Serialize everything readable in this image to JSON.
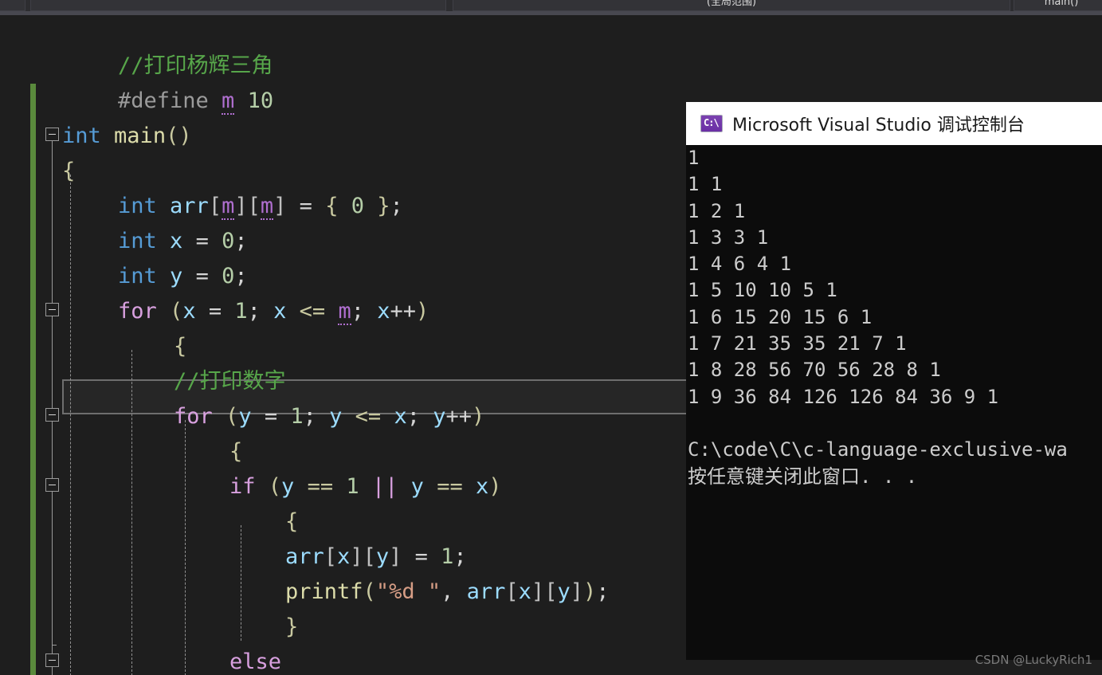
{
  "navbar": {
    "left_label": "",
    "scope_label": "",
    "middle_label": "(全局范围)",
    "member_label": "main()"
  },
  "editor": {
    "language": "C",
    "colors": {
      "background": "#1e1e1e",
      "comment": "#57a64a",
      "keyword": "#569cd6",
      "control_keyword": "#d8a0df",
      "function": "#dcdcaa",
      "variable": "#9cdcfe",
      "number": "#b5cea8",
      "string": "#d69d85",
      "macro": "#b06fd0",
      "change_bar_saved": "#5a8a3c",
      "current_line_border": "#6e6e6e"
    },
    "current_line_index": 8,
    "lines": [
      {
        "indent": 1,
        "tokens": [
          {
            "t": "//打印杨辉三角",
            "c": "c-comment"
          }
        ]
      },
      {
        "indent": 1,
        "tokens": [
          {
            "t": "#define ",
            "c": "c-pp"
          },
          {
            "t": "m",
            "c": "c-macro"
          },
          {
            "t": " ",
            "c": "c-punct"
          },
          {
            "t": "10",
            "c": "c-num"
          }
        ]
      },
      {
        "indent": 0,
        "tokens": [
          {
            "t": "int",
            "c": "c-key"
          },
          {
            "t": " ",
            "c": "c-punct"
          },
          {
            "t": "main",
            "c": "c-fn"
          },
          {
            "t": "()",
            "c": "c-brace"
          }
        ]
      },
      {
        "indent": 0,
        "tokens": [
          {
            "t": "{",
            "c": "c-brace"
          }
        ]
      },
      {
        "indent": 1,
        "tokens": [
          {
            "t": "int",
            "c": "c-key"
          },
          {
            "t": " ",
            "c": "c-punct"
          },
          {
            "t": "arr",
            "c": "c-var"
          },
          {
            "t": "[",
            "c": "c-brk"
          },
          {
            "t": "m",
            "c": "c-macro"
          },
          {
            "t": "]",
            "c": "c-brk"
          },
          {
            "t": "[",
            "c": "c-brk"
          },
          {
            "t": "m",
            "c": "c-macro"
          },
          {
            "t": "]",
            "c": "c-brk"
          },
          {
            "t": " = ",
            "c": "c-punct"
          },
          {
            "t": "{ ",
            "c": "c-brace"
          },
          {
            "t": "0",
            "c": "c-num"
          },
          {
            "t": " }",
            "c": "c-brace"
          },
          {
            "t": ";",
            "c": "c-punct"
          }
        ]
      },
      {
        "indent": 1,
        "tokens": [
          {
            "t": "int",
            "c": "c-key"
          },
          {
            "t": " ",
            "c": "c-punct"
          },
          {
            "t": "x",
            "c": "c-var"
          },
          {
            "t": " = ",
            "c": "c-punct"
          },
          {
            "t": "0",
            "c": "c-num"
          },
          {
            "t": ";",
            "c": "c-punct"
          }
        ]
      },
      {
        "indent": 1,
        "tokens": [
          {
            "t": "int",
            "c": "c-key"
          },
          {
            "t": " ",
            "c": "c-punct"
          },
          {
            "t": "y",
            "c": "c-var"
          },
          {
            "t": " = ",
            "c": "c-punct"
          },
          {
            "t": "0",
            "c": "c-num"
          },
          {
            "t": ";",
            "c": "c-punct"
          }
        ]
      },
      {
        "indent": 1,
        "tokens": [
          {
            "t": "for",
            "c": "c-ctrl"
          },
          {
            "t": " ",
            "c": "c-punct"
          },
          {
            "t": "(",
            "c": "c-brace"
          },
          {
            "t": "x",
            "c": "c-var"
          },
          {
            "t": " = ",
            "c": "c-punct"
          },
          {
            "t": "1",
            "c": "c-num"
          },
          {
            "t": "; ",
            "c": "c-punct"
          },
          {
            "t": "x",
            "c": "c-var"
          },
          {
            "t": " ",
            "c": "c-punct"
          },
          {
            "t": "<=",
            "c": "c-brace"
          },
          {
            "t": " ",
            "c": "c-punct"
          },
          {
            "t": "m",
            "c": "c-macro"
          },
          {
            "t": "; ",
            "c": "c-punct"
          },
          {
            "t": "x",
            "c": "c-var"
          },
          {
            "t": "++",
            "c": "c-punct"
          },
          {
            "t": ")",
            "c": "c-brace"
          }
        ]
      },
      {
        "indent": 2,
        "tokens": [
          {
            "t": "{",
            "c": "c-brace"
          }
        ]
      },
      {
        "indent": 2,
        "tokens": [
          {
            "t": "//打印数字",
            "c": "c-comment"
          }
        ]
      },
      {
        "indent": 2,
        "tokens": [
          {
            "t": "for",
            "c": "c-ctrl"
          },
          {
            "t": " ",
            "c": "c-punct"
          },
          {
            "t": "(",
            "c": "c-brace"
          },
          {
            "t": "y",
            "c": "c-var"
          },
          {
            "t": " = ",
            "c": "c-punct"
          },
          {
            "t": "1",
            "c": "c-num"
          },
          {
            "t": "; ",
            "c": "c-punct"
          },
          {
            "t": "y",
            "c": "c-var"
          },
          {
            "t": " ",
            "c": "c-punct"
          },
          {
            "t": "<=",
            "c": "c-brace"
          },
          {
            "t": " ",
            "c": "c-punct"
          },
          {
            "t": "x",
            "c": "c-var"
          },
          {
            "t": "; ",
            "c": "c-punct"
          },
          {
            "t": "y",
            "c": "c-var"
          },
          {
            "t": "++",
            "c": "c-punct"
          },
          {
            "t": ")",
            "c": "c-brace"
          }
        ]
      },
      {
        "indent": 3,
        "tokens": [
          {
            "t": "{",
            "c": "c-brace"
          }
        ]
      },
      {
        "indent": 3,
        "tokens": [
          {
            "t": "if",
            "c": "c-ctrl"
          },
          {
            "t": " ",
            "c": "c-punct"
          },
          {
            "t": "(",
            "c": "c-brace"
          },
          {
            "t": "y",
            "c": "c-var"
          },
          {
            "t": " ",
            "c": "c-punct"
          },
          {
            "t": "==",
            "c": "c-brace"
          },
          {
            "t": " ",
            "c": "c-punct"
          },
          {
            "t": "1",
            "c": "c-num"
          },
          {
            "t": " ",
            "c": "c-punct"
          },
          {
            "t": "||",
            "c": "c-ctrl"
          },
          {
            "t": " ",
            "c": "c-punct"
          },
          {
            "t": "y",
            "c": "c-var"
          },
          {
            "t": " ",
            "c": "c-punct"
          },
          {
            "t": "==",
            "c": "c-brace"
          },
          {
            "t": " ",
            "c": "c-punct"
          },
          {
            "t": "x",
            "c": "c-var"
          },
          {
            "t": ")",
            "c": "c-brace"
          }
        ]
      },
      {
        "indent": 4,
        "tokens": [
          {
            "t": "{",
            "c": "c-brace"
          }
        ]
      },
      {
        "indent": 4,
        "tokens": [
          {
            "t": "arr",
            "c": "c-var"
          },
          {
            "t": "[",
            "c": "c-brk"
          },
          {
            "t": "x",
            "c": "c-var"
          },
          {
            "t": "]",
            "c": "c-brk"
          },
          {
            "t": "[",
            "c": "c-brk"
          },
          {
            "t": "y",
            "c": "c-var"
          },
          {
            "t": "]",
            "c": "c-brk"
          },
          {
            "t": " = ",
            "c": "c-punct"
          },
          {
            "t": "1",
            "c": "c-num"
          },
          {
            "t": ";",
            "c": "c-punct"
          }
        ]
      },
      {
        "indent": 4,
        "tokens": [
          {
            "t": "printf",
            "c": "c-fn"
          },
          {
            "t": "(",
            "c": "c-brace"
          },
          {
            "t": "\"%d \"",
            "c": "c-str"
          },
          {
            "t": ", ",
            "c": "c-punct"
          },
          {
            "t": "arr",
            "c": "c-var"
          },
          {
            "t": "[",
            "c": "c-brk"
          },
          {
            "t": "x",
            "c": "c-var"
          },
          {
            "t": "]",
            "c": "c-brk"
          },
          {
            "t": "[",
            "c": "c-brk"
          },
          {
            "t": "y",
            "c": "c-var"
          },
          {
            "t": "]",
            "c": "c-brk"
          },
          {
            "t": ")",
            "c": "c-brace"
          },
          {
            "t": ";",
            "c": "c-punct"
          }
        ]
      },
      {
        "indent": 4,
        "tokens": [
          {
            "t": "}",
            "c": "c-brace"
          }
        ]
      },
      {
        "indent": 3,
        "tokens": [
          {
            "t": "else",
            "c": "c-ctrl"
          }
        ]
      }
    ]
  },
  "console": {
    "title": "Microsoft Visual Studio 调试控制台",
    "icon": "console-icon",
    "output_lines": [
      "1",
      "1 1",
      "1 2 1",
      "1 3 3 1",
      "1 4 6 4 1",
      "1 5 10 10 5 1",
      "1 6 15 20 15 6 1",
      "1 7 21 35 35 21 7 1",
      "1 8 28 56 70 56 28 8 1",
      "1 9 36 84 126 126 84 36 9 1",
      "",
      "C:\\code\\C\\c-language-exclusive-wa",
      "按任意键关闭此窗口. . ."
    ]
  },
  "watermark": {
    "text": "CSDN @LuckyRich1"
  }
}
